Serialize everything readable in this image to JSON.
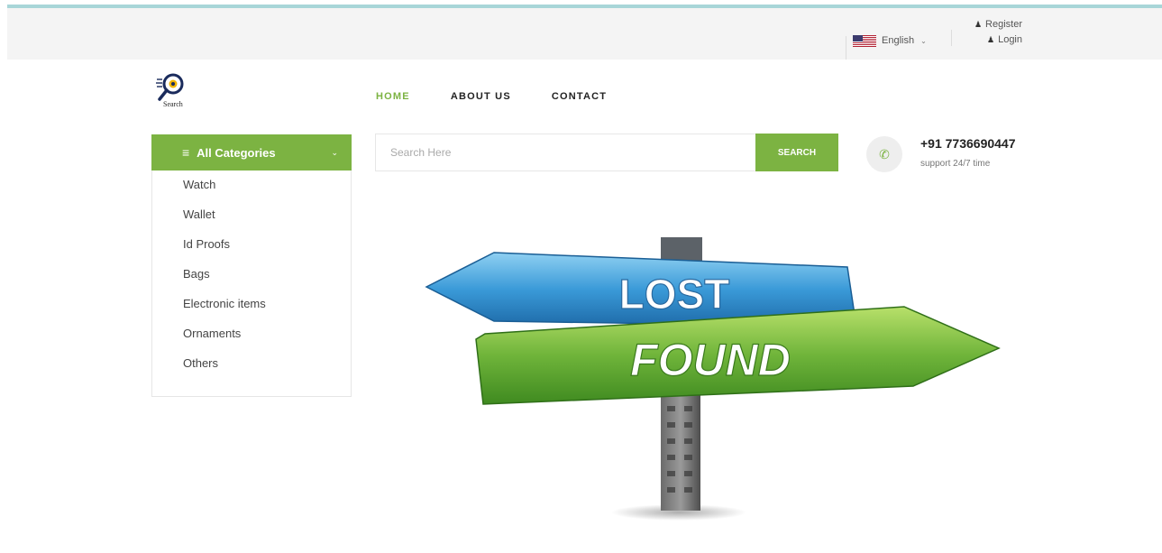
{
  "topbar": {
    "language": "English",
    "register": "Register",
    "login": "Login"
  },
  "logo": {
    "text": "Search"
  },
  "nav": {
    "home": "HOME",
    "about": "ABOUT US",
    "contact": "CONTACT"
  },
  "categories": {
    "title": "All Categories",
    "items": [
      "Watch",
      "Wallet",
      "Id Proofs",
      "Bags",
      "Electronic items",
      "Ornaments",
      "Others"
    ]
  },
  "search": {
    "placeholder": "Search Here",
    "button": "SEARCH"
  },
  "contact": {
    "phone": "+91 7736690447",
    "support": "support 24/7 time"
  },
  "banner": {
    "sign_top": "LOST",
    "sign_bottom": "FOUND"
  },
  "colors": {
    "accent": "#7cb342",
    "topbar_bg": "#f4f4f4",
    "top_accent": "#a8d6d8"
  },
  "icons": [
    "flag-us-icon",
    "chevron-down-icon",
    "user-icon",
    "menu-icon",
    "phone-icon"
  ]
}
